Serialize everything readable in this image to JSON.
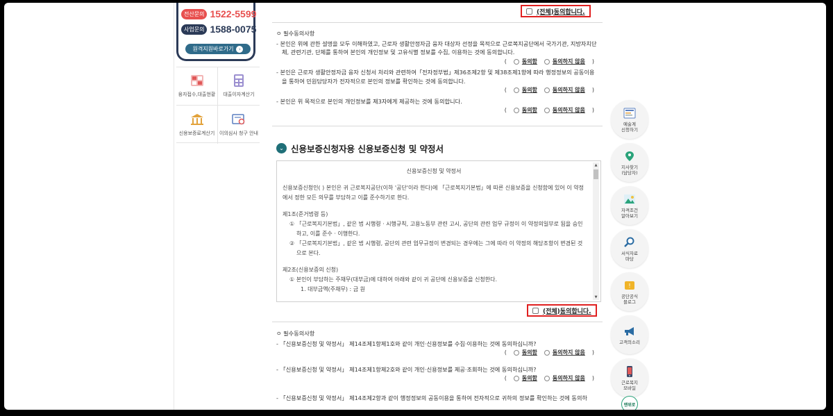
{
  "contact": {
    "consult_tag": "전산문의",
    "consult_phone": "1522-5599",
    "business_tag": "사업문의",
    "business_phone": "1588-0075",
    "remote_support": "원격지원바로가기"
  },
  "quick_menu": [
    {
      "label": "융자접수,대출현황",
      "icon": "calculator-sheet-icon"
    },
    {
      "label": "대출이자계산기",
      "icon": "calculator-icon"
    },
    {
      "label": "신용보증료계산기",
      "icon": "building-icon"
    },
    {
      "label": "이의심사 청구 안내",
      "icon": "document-search-icon"
    }
  ],
  "agree_all_label": "(전체)동의합니다.",
  "radio": {
    "agree": "동의함",
    "disagree": "동의하지 않음"
  },
  "consent1": {
    "title": "ㅇ 필수동의사항",
    "items": [
      "- 본인은 위에 관한 설명을 모두 이해하였고, 근로자 생활안정자금 융자 대상자 선정을 목적으로 근로복지공단에서 국가기관, 지방자치단체, 관련기관, 단체를 통하여 본인의 개인정보 및 고유식별 정보를 수집, 이용하는 것에 동의합니다.",
      "- 본인은 근로자 생활안정자금 융자 신청서 처리와 관련하여「전자정부법」제36조제2항 및 제38조제1항에 따라 행정정보의 공동이용을 통하여 민원담당자가 전자적으로 본인의 정보를 확인하는 것에 동의합니다.",
      "- 본인은 위 목적으로 본인의 개인정보를 제3자에게 제공하는 것에 동의합니다."
    ]
  },
  "section_title": "신용보증신청자용 신용보증신청 및 약정서",
  "terms": {
    "heading": "신용보증신청 및 약정서",
    "intro": "신용보증신청인( ) 본인은 귀 근로복지공단(이하 '공단'이라 한다)에 「근로복지기본법」에 따른 신용보증을 신청함에 있어 이 약정에서 정한 모든 의무를 부담하고 이를 준수하기로 한다.",
    "art1": "제1조(준거법령 등)",
    "art1_1": "① 「근로복지기본법」, 같은 법 시행령 · 시행규칙, 고용노동부 관련 고시, 공단의 관련 업무 규정이 이 약정의일부로 됨을 승인하고, 이를 준수 · 이행한다.",
    "art1_2": "② 「근로복지기본법」, 같은 법 시행령, 공단의 관련 업무규정이 변경되는 경우에는 그에 따라 이 약정의 해당조항이 변경된 것으로 본다.",
    "art2": "제2조(신용보증의 신청)",
    "art2_1": "① 본인이 부담하는 주채무(대부금)에 대하여 아래와 같이 귀 공단에 신용보증을 신청한다.",
    "art2_1_1": "1. 대부금액(주채무) : 금 원"
  },
  "consent2": {
    "title": "ㅇ 필수동의사항",
    "items": [
      "- 「신용보증신청 및 약정서」 제14조제1항제1호와 같이 개인·신용정보를 수집·이용하는 것에 동의하십니까?",
      "- 「신용보증신청 및 약정서」 제14조제1항제2호와 같이 개인·신용정보를 제공·조회하는 것에 동의하십니까?",
      "- 「신용보증신청 및 약정서」 제14조제2항과 같이 행정정보의 공동이용을 통하여 전자적으로 귀하의 정보를 확인하는 것에 동의하"
    ]
  },
  "right_menu": [
    {
      "label": "예술계\n신청하기",
      "icon": "form-icon"
    },
    {
      "label": "지사찾기\n(담당자)",
      "icon": "location-pin-icon"
    },
    {
      "label": "자격조건\n알아보기",
      "icon": "landscape-icon"
    },
    {
      "label": "서식자료\n마당",
      "icon": "magnifier-icon"
    },
    {
      "label": "공단공식\n블로그",
      "icon": "blog-icon"
    },
    {
      "label": "고객의소리",
      "icon": "megaphone-icon"
    },
    {
      "label": "근로복지\n모바일",
      "icon": "mobile-icon"
    }
  ],
  "top_button": "맨위로",
  "colors": {
    "accent": "#e02020",
    "tag_red": "#e8504f",
    "tag_navy": "#2b3a57",
    "teal": "#1f6f78"
  }
}
